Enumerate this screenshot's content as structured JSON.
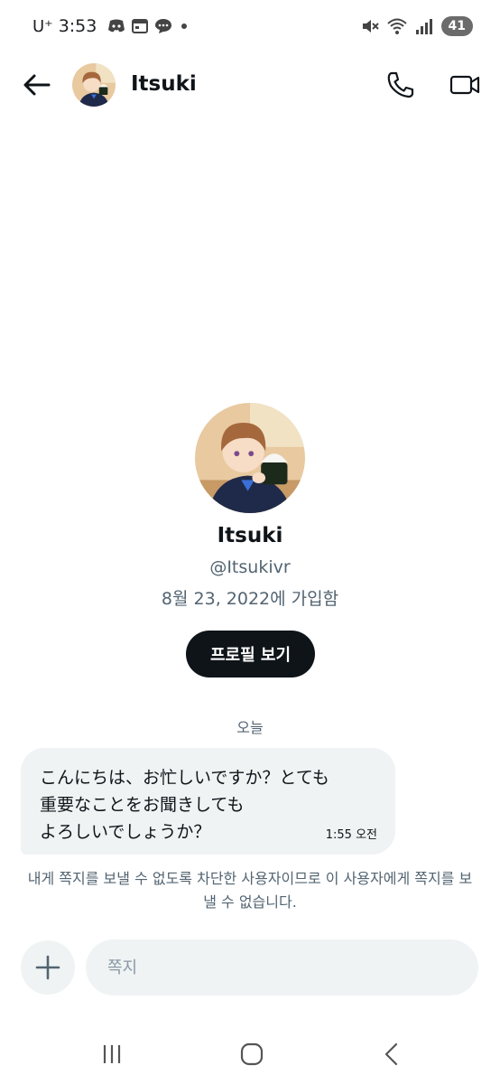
{
  "status_bar": {
    "carrier": "U⁺",
    "time": "3:53",
    "battery": "41",
    "icons": [
      "discord-icon",
      "calendar-icon",
      "chat-icon",
      "notification-dot",
      "mute-icon",
      "wifi-icon",
      "signal-icon"
    ]
  },
  "header": {
    "title": "Itsuki",
    "back_icon": "arrow-left-icon",
    "call_icon": "phone-icon",
    "video_icon": "video-camera-icon"
  },
  "profile": {
    "name": "Itsuki",
    "handle": "@Itsukivr",
    "joined": "8월 23, 2022에 가입함",
    "view_profile_label": "프로필 보기"
  },
  "conversation": {
    "date_divider": "오늘",
    "messages": [
      {
        "text": "こんにちは、お忙しいですか？とても\n重要なことをお聞きしても\nよろしいでしょうか？",
        "time": "1:55 오전"
      }
    ],
    "blocked_notice": "내게 쪽지를 보낼 수 없도록 차단한 사용자이므로 이 사용자에게 쪽지를 보낼 수 없습니다."
  },
  "composer": {
    "placeholder": "쪽지",
    "value": "",
    "add_icon": "plus-icon"
  },
  "nav_bar": {
    "icons": [
      "recent-apps-icon",
      "home-icon",
      "back-icon"
    ]
  },
  "colors": {
    "text_primary": "#0f1419",
    "text_secondary": "#536471",
    "bubble_bg": "#eff3f4",
    "button_bg": "#0f1419"
  }
}
